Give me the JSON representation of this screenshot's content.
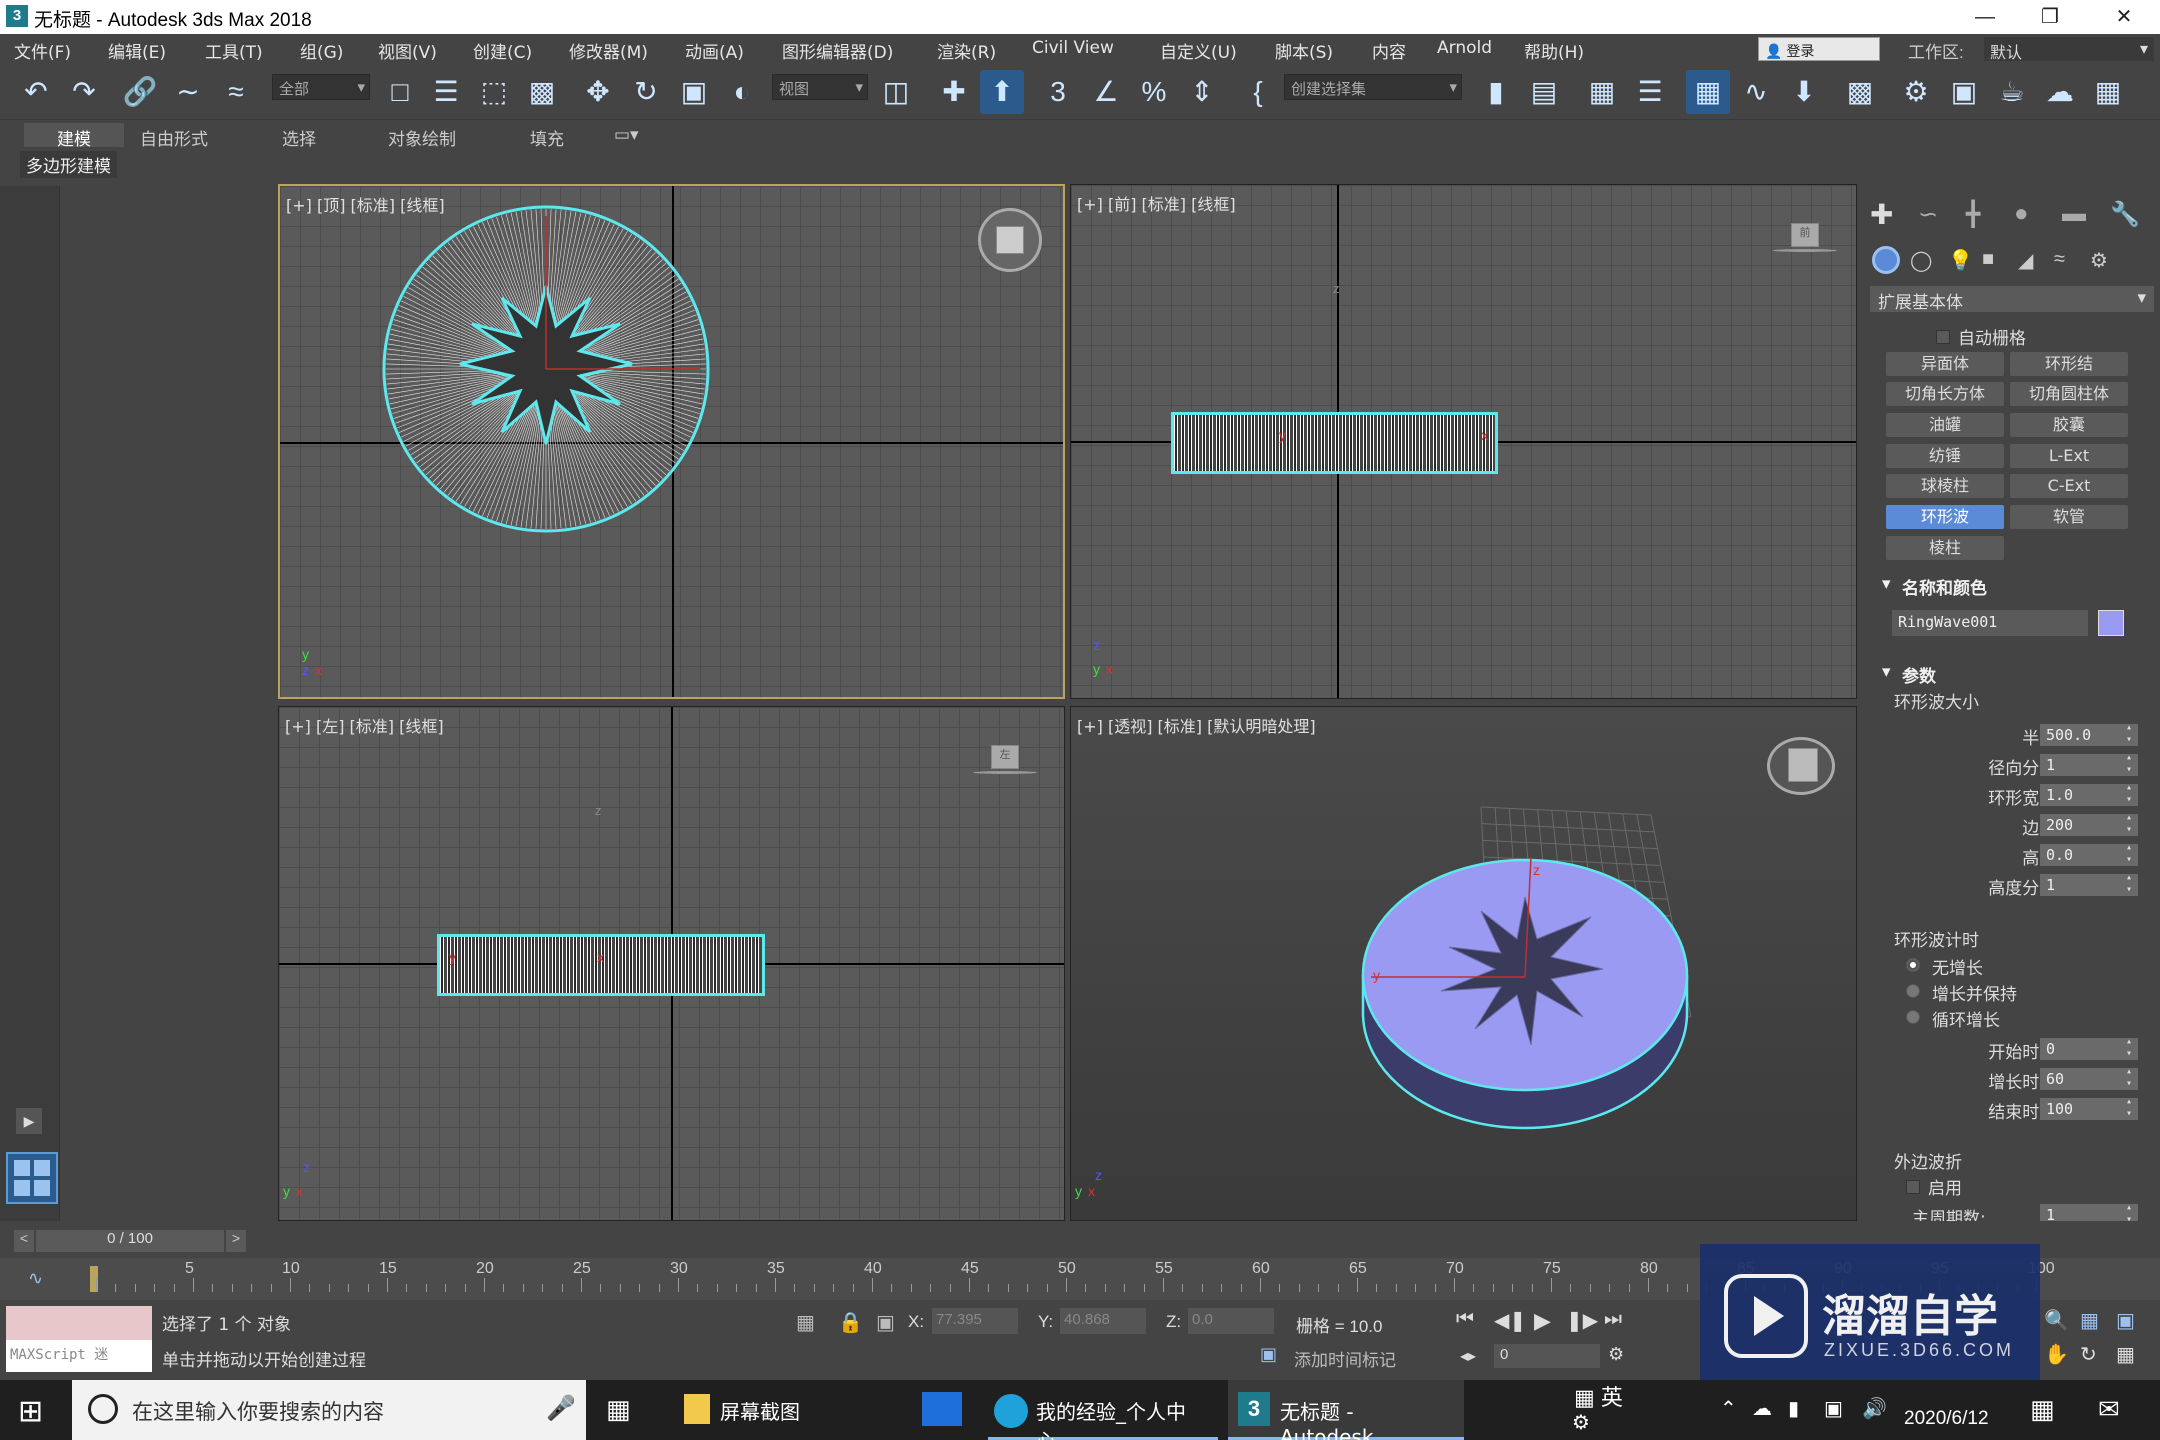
{
  "window": {
    "title": "无标题 - Autodesk 3ds Max 2018",
    "app_icon": "3",
    "minimize": "—",
    "maximize": "❐",
    "close": "✕"
  },
  "menu": {
    "items": [
      "文件(F)",
      "编辑(E)",
      "工具(T)",
      "组(G)",
      "视图(V)",
      "创建(C)",
      "修改器(M)",
      "动画(A)",
      "图形编辑器(D)",
      "渲染(R)",
      "Civil View",
      "自定义(U)",
      "脚本(S)",
      "内容",
      "Arnold",
      "帮助(H)"
    ],
    "login": "登录",
    "workspace_label": "工作区:",
    "workspace_value": "默认"
  },
  "toolbar": {
    "filter_dropdown": "全部",
    "coord_dropdown": "视图",
    "selection_set_dropdown": "创建选择集"
  },
  "ribbon": {
    "tabs": [
      "建模",
      "自由形式",
      "选择",
      "对象绘制",
      "填充"
    ],
    "active_tab": "建模",
    "sub_label": "多边形建模"
  },
  "viewports": {
    "top": "[+] [顶] [标准] [线框]",
    "front": "[+] [前] [标准] [线框]",
    "left": "[+] [左] [标准] [线框]",
    "perspective": "[+] [透视] [标准] [默认明暗处理]",
    "front_cube": "前",
    "left_cube": "左",
    "axis_x": "x",
    "axis_y": "y",
    "axis_z": "z"
  },
  "command_panel": {
    "category_dropdown": "扩展基本体",
    "autogrid_label": "自动栅格",
    "object_buttons": [
      [
        "异面体",
        "环形结"
      ],
      [
        "切角长方体",
        "切角圆柱体"
      ],
      [
        "油罐",
        "胶囊"
      ],
      [
        "纺锤",
        "L-Ext"
      ],
      [
        "球棱柱",
        "C-Ext"
      ],
      [
        "环形波",
        "软管"
      ],
      [
        "棱柱",
        ""
      ]
    ],
    "active_button": "环形波",
    "name_color_title": "名称和颜色",
    "object_name": "RingWave001",
    "object_color": "#9a9af2",
    "params_title": "参数",
    "ring_size_title": "环形波大小",
    "params": [
      {
        "label": "半径:",
        "value": "500.0"
      },
      {
        "label": "径向分段:",
        "value": "1"
      },
      {
        "label": "环形宽度:",
        "value": "1.0"
      },
      {
        "label": "边数:",
        "value": "200"
      },
      {
        "label": "高度:",
        "value": "0.0"
      },
      {
        "label": "高度分段:",
        "value": "1"
      }
    ],
    "timing_title": "环形波计时",
    "radios": [
      "无增长",
      "增长并保持",
      "循环增长"
    ],
    "radio_selected": 0,
    "timing": [
      {
        "label": "开始时间:",
        "value": "0"
      },
      {
        "label": "增长时间:",
        "value": "60"
      },
      {
        "label": "结束时间:",
        "value": "100"
      }
    ],
    "outer_title": "外边波折",
    "outer_enable": "启用",
    "outer_partial": "主周期数:",
    "outer_partial_value": "1"
  },
  "timeline": {
    "slider_text": "0 / 100",
    "ticks": [
      "5",
      "10",
      "15",
      "20",
      "25",
      "30",
      "35",
      "40",
      "45",
      "50",
      "55",
      "60",
      "65",
      "70",
      "75",
      "80",
      "85",
      "90",
      "95",
      "100"
    ]
  },
  "status": {
    "maxscript": "MAXScript 迷",
    "selection": "选择了 1 个 对象",
    "prompt": "单击并拖动以开始创建过程",
    "x_label": "X:",
    "x_value": "77.395",
    "y_label": "Y:",
    "y_value": "40.868",
    "z_label": "Z:",
    "z_value": "0.0",
    "grid": "栅格 = 10.0",
    "add_time_tag": "添加时间标记",
    "frame_value": "0"
  },
  "watermark": {
    "brand": "溜溜自学",
    "url": "ZIXUE.3D66.COM"
  },
  "taskbar": {
    "search_placeholder": "在这里输入你要搜索的内容",
    "apps": [
      "屏幕截图",
      "我的经验_个人中心...",
      "无标题 - Autodesk..."
    ],
    "ime": "英",
    "date": "2020/6/12"
  }
}
